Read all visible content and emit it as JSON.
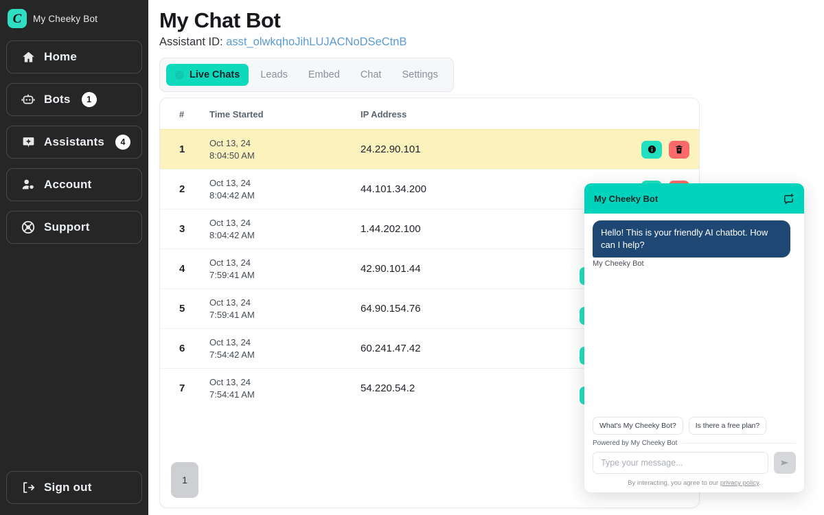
{
  "sidebar": {
    "brand": {
      "name": "My Cheeky Bot",
      "logo_letter": "C",
      "logo_color": "#2fddc3"
    },
    "items": [
      {
        "label": "Home",
        "icon": "home-icon",
        "badge": null
      },
      {
        "label": "Bots",
        "icon": "robot-icon",
        "badge": "1"
      },
      {
        "label": "Assistants",
        "icon": "sparkle-badge-icon",
        "badge": "4"
      },
      {
        "label": "Account",
        "icon": "user-gear-icon",
        "badge": null
      },
      {
        "label": "Support",
        "icon": "lifebuoy-icon",
        "badge": null
      }
    ],
    "signout": {
      "label": "Sign out",
      "icon": "sign-out-icon"
    }
  },
  "header": {
    "title": "My Chat Bot",
    "assistant_label": "Assistant ID:",
    "assistant_id": "asst_olwkqhoJihLUJACNoDSeCtnB",
    "assistant_id_color": "#5b9bd5"
  },
  "tabs": {
    "active": "Live Chats",
    "items": [
      {
        "label": "Live Chats",
        "active": true,
        "icon": "live-dot-icon"
      },
      {
        "label": "Leads",
        "active": false
      },
      {
        "label": "Embed",
        "active": false
      },
      {
        "label": "Chat",
        "active": false
      },
      {
        "label": "Settings",
        "active": false
      }
    ]
  },
  "table": {
    "columns": [
      "#",
      "Time Started",
      "IP Address",
      ""
    ],
    "rows": [
      {
        "num": "1",
        "date": "Oct 13, 24",
        "time": "8:04:50 AM",
        "ip": "24.22.90.101",
        "highlighted": true,
        "actions": [
          "info",
          "delete"
        ]
      },
      {
        "num": "2",
        "date": "Oct 13, 24",
        "time": "8:04:42 AM",
        "ip": "44.101.34.200",
        "highlighted": false,
        "actions": [
          "info",
          "delete"
        ]
      },
      {
        "num": "3",
        "date": "Oct 13, 24",
        "time": "8:04:42 AM",
        "ip": "1.44.202.100",
        "highlighted": false,
        "actions": [
          "info",
          "delete"
        ]
      },
      {
        "num": "4",
        "date": "Oct 13, 24",
        "time": "7:59:41 AM",
        "ip": "42.90.101.44",
        "highlighted": false,
        "actions": [
          "info",
          "delete"
        ]
      },
      {
        "num": "5",
        "date": "Oct 13, 24",
        "time": "7:59:41 AM",
        "ip": "64.90.154.76",
        "highlighted": false,
        "actions": [
          "info",
          "delete"
        ]
      },
      {
        "num": "6",
        "date": "Oct 13, 24",
        "time": "7:54:42 AM",
        "ip": "60.241.47.42",
        "highlighted": false,
        "actions": [
          "info",
          "delete"
        ]
      },
      {
        "num": "7",
        "date": "Oct 13, 24",
        "time": "7:54:41 AM",
        "ip": "54.220.54.2",
        "highlighted": false,
        "actions": [
          "info",
          "delete"
        ]
      }
    ],
    "highlight_color": "#fbf2bd"
  },
  "pagination": {
    "pages": [
      "1"
    ],
    "current": "1"
  },
  "chat_widget": {
    "header_title": "My Cheeky Bot",
    "header_color": "#00d3bb",
    "new_chat_icon": "new-chat-icon",
    "messages": [
      {
        "text": "Hello! This is your friendly AI chatbot. How can I help?",
        "author": "My Cheeky Bot",
        "bubble_color": "#1e4873"
      }
    ],
    "quick_replies": [
      "What's My Cheeky Bot?",
      "Is there a free plan?"
    ],
    "powered_by": "Powered by My Cheeky Bot",
    "input_placeholder": "Type your message...",
    "input_value": "",
    "send_icon": "send-icon",
    "legal_prefix": "By interacting, you agree to our ",
    "legal_link": "privacy policy",
    "legal_suffix": "."
  }
}
